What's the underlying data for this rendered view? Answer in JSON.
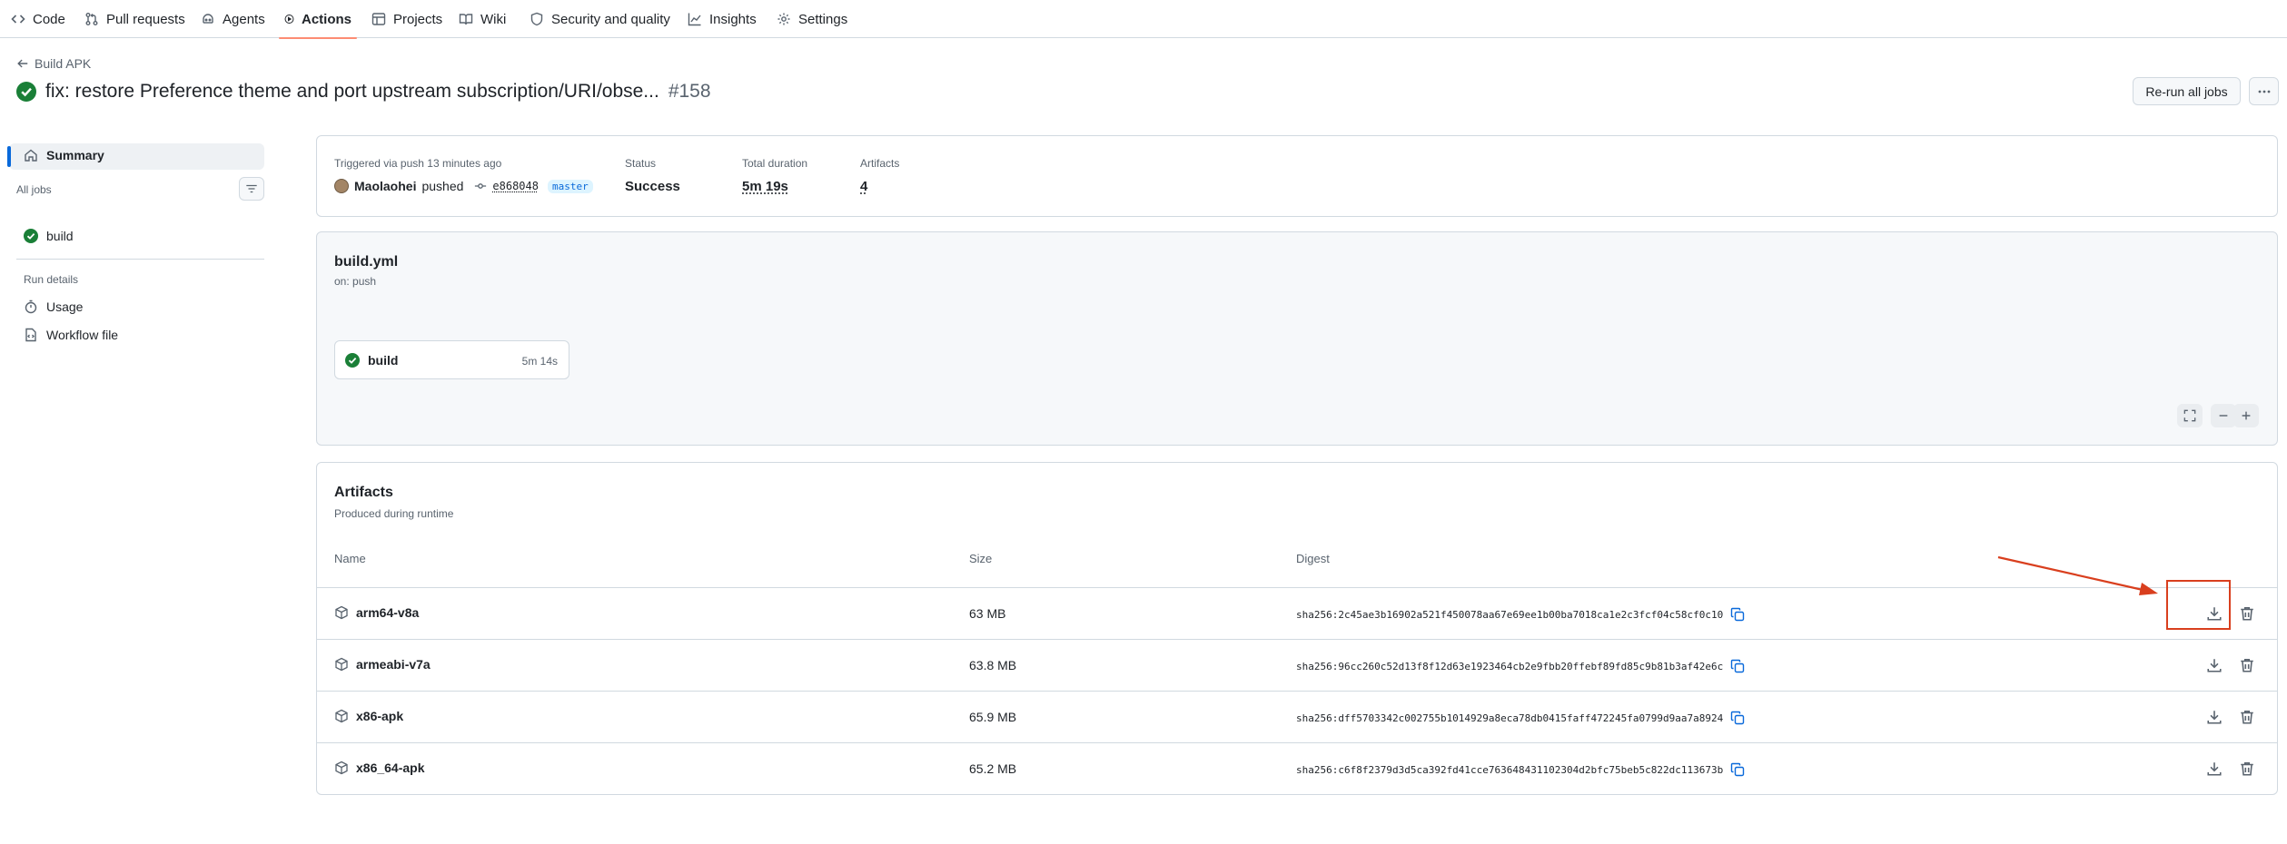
{
  "nav": {
    "tabs": [
      {
        "label": "Code",
        "icon": "code-icon"
      },
      {
        "label": "Pull requests",
        "icon": "pull-request-icon"
      },
      {
        "label": "Agents",
        "icon": "agent-icon"
      },
      {
        "label": "Actions",
        "icon": "play-icon",
        "active": true
      },
      {
        "label": "Projects",
        "icon": "table-icon"
      },
      {
        "label": "Wiki",
        "icon": "book-icon"
      },
      {
        "label": "Security and quality",
        "icon": "shield-icon"
      },
      {
        "label": "Insights",
        "icon": "graph-icon"
      },
      {
        "label": "Settings",
        "icon": "gear-icon"
      }
    ]
  },
  "header": {
    "back_label": "Build APK",
    "title": "fix: restore Preference theme and port upstream subscription/URI/obse...",
    "run_number": "#158",
    "rerun_label": "Re-run all jobs"
  },
  "sidebar": {
    "summary_label": "Summary",
    "all_jobs_label": "All jobs",
    "job_label": "build",
    "run_details_label": "Run details",
    "usage_label": "Usage",
    "workflow_file_label": "Workflow file"
  },
  "summary": {
    "triggered_label": "Triggered via push 13 minutes ago",
    "actor": "Maolaohei",
    "action": "pushed",
    "commit": "e868048",
    "branch": "master",
    "status_label": "Status",
    "status_value": "Success",
    "duration_label": "Total duration",
    "duration_value": "5m 19s",
    "artifacts_label": "Artifacts",
    "artifacts_value": "4"
  },
  "workflow": {
    "file": "build.yml",
    "trigger": "on: push",
    "job_name": "build",
    "job_duration": "5m 14s"
  },
  "artifacts": {
    "title": "Artifacts",
    "subtitle": "Produced during runtime",
    "columns": {
      "name": "Name",
      "size": "Size",
      "digest": "Digest"
    },
    "rows": [
      {
        "name": "arm64-v8a",
        "size": "63 MB",
        "digest": "sha256:2c45ae3b16902a521f450078aa67e69ee1b00ba7018ca1e2c3fcf04c58cf0c10"
      },
      {
        "name": "armeabi-v7a",
        "size": "63.8 MB",
        "digest": "sha256:96cc260c52d13f8f12d63e1923464cb2e9fbb20ffebf89fd85c9b81b3af42e6c"
      },
      {
        "name": "x86-apk",
        "size": "65.9 MB",
        "digest": "sha256:dff5703342c002755b1014929a8eca78db0415faff472245fa0799d9aa7a8924"
      },
      {
        "name": "x86_64-apk",
        "size": "65.2 MB",
        "digest": "sha256:c6f8f2379d3d5ca392fd41cce763648431102304d2bfc75beb5c822dc113673b"
      }
    ]
  },
  "colors": {
    "success": "#1a7f37",
    "accent": "#0969da",
    "annotation": "#d93f1e"
  }
}
